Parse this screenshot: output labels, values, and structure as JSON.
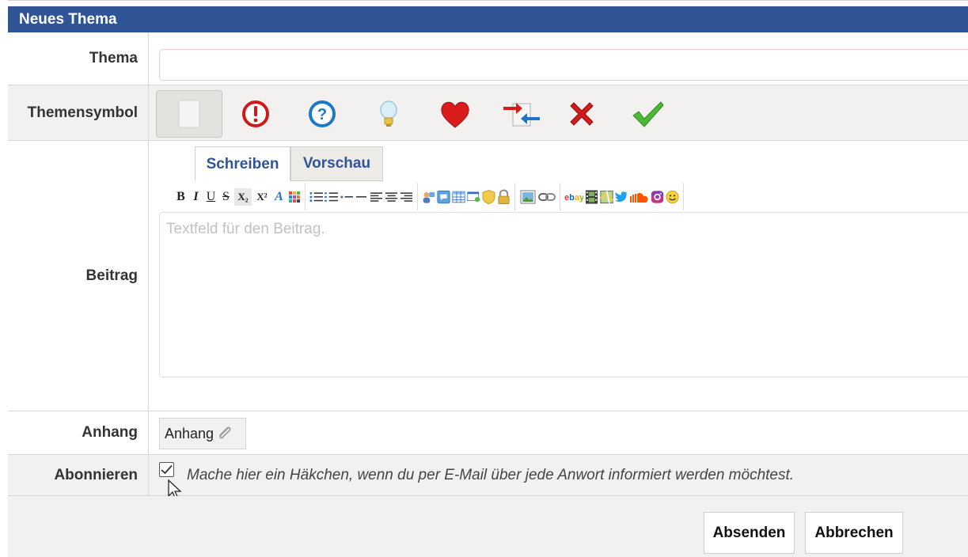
{
  "form": {
    "title": "Neues Thema",
    "thema": {
      "label": "Thema",
      "value": ""
    },
    "themensymbol": {
      "label": "Themensymbol",
      "icons": [
        "blank-icon",
        "exclamation-icon",
        "question-icon",
        "lightbulb-icon",
        "heart-icon",
        "arrows-icon",
        "cross-icon",
        "checkmark-icon"
      ],
      "selected": "blank-icon"
    },
    "beitrag": {
      "label": "Beitrag",
      "tabs": [
        "Schreiben",
        "Vorschau"
      ],
      "active_tab": "Schreiben",
      "placeholder": "Textfeld für den Beitrag.",
      "toolbar": {
        "bold": "B",
        "italic": "I",
        "underline": "U",
        "strike": "S",
        "subscript": "X₂",
        "superscript": "X²",
        "font": "A"
      }
    },
    "anhang": {
      "label": "Anhang",
      "button": "Anhang"
    },
    "abonnieren": {
      "label": "Abonnieren",
      "checked": true,
      "text": "Mache hier ein Häkchen, wenn du per E-Mail über jede Anwort informiert werden möchtest."
    },
    "actions": {
      "send": "Absenden",
      "cancel": "Abbrechen"
    }
  },
  "colors": {
    "header": "#2f5597",
    "row_alt": "#f2f1ef",
    "tab_text": "#2f5597"
  }
}
